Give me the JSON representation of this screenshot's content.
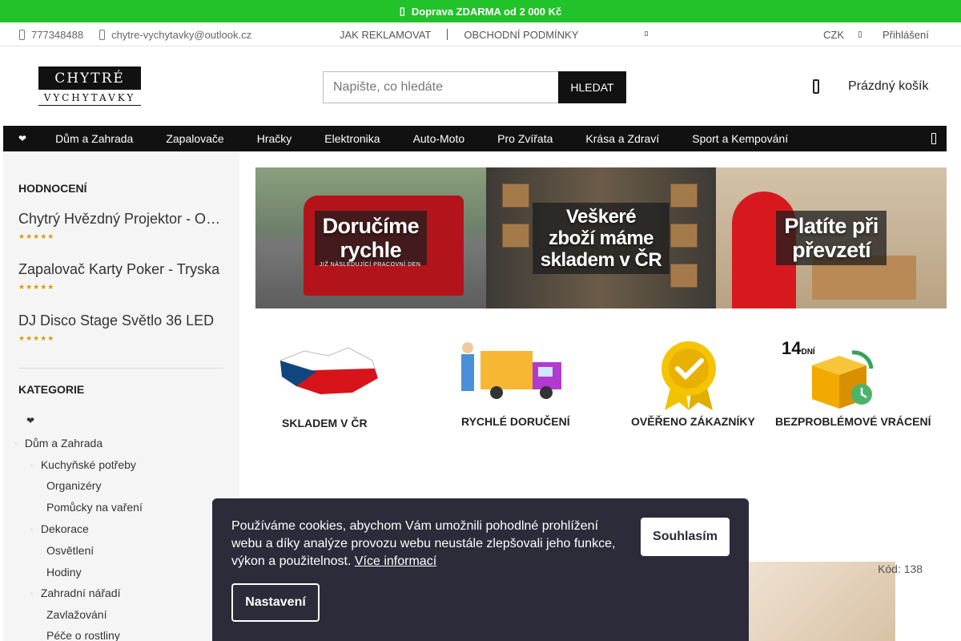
{
  "promo": {
    "text": "Doprava ZDARMA od 2 000 Kč"
  },
  "utility": {
    "phone": "777348488",
    "email": "chytre-vychytavky@outlook.cz",
    "links": [
      "JAK REKLAMOVAT",
      "OBCHODNÍ PODMÍNKY"
    ],
    "currency": "CZK",
    "login": "Přihlášení"
  },
  "header": {
    "logo_top": "CHYTRÉ",
    "logo_bottom": "VYCHYTAVKY",
    "search_placeholder": "Napište, co hledáte",
    "search_button": "HLEDAT",
    "cart": "Prázdný košík"
  },
  "nav": {
    "heart": "❤",
    "items": [
      "Dům a Zahrada",
      "Zapalovače",
      "Hračky",
      "Elektronika",
      "Auto-Moto",
      "Pro Zvířata",
      "Krása a Zdraví",
      "Sport a Kempování"
    ]
  },
  "sidebar": {
    "reviews_title": "HODNOCENÍ",
    "reviews": [
      {
        "name": "Chytrý Hvězdný Projektor - Oceán",
        "stars": "★★★★★"
      },
      {
        "name": "Zapalovač Karty Poker - Tryska",
        "stars": "★★★★★"
      },
      {
        "name": "DJ Disco Stage Světlo 36 LED",
        "stars": "★★★★★"
      }
    ],
    "categories_title": "KATEGORIE",
    "categories": [
      {
        "label": "❤",
        "level": 0
      },
      {
        "label": "Dům a Zahrada",
        "level": 1
      },
      {
        "label": "Kuchyňské potřeby",
        "level": 2
      },
      {
        "label": "Organizéry",
        "level": 3
      },
      {
        "label": "Pomůcky na vaření",
        "level": 3
      },
      {
        "label": "Dekorace",
        "level": 2
      },
      {
        "label": "Osvětlení",
        "level": 3
      },
      {
        "label": "Hodiny",
        "level": 3
      },
      {
        "label": "Zahradní nářadí",
        "level": 2
      },
      {
        "label": "Zavlažování",
        "level": 3
      },
      {
        "label": "Péče o rostliny",
        "level": 3
      }
    ]
  },
  "banners": [
    {
      "line1": "Doručíme",
      "line2": "rychle",
      "sub": "JIŽ NÁSLEDUJÍCÍ PRACOVNÍ DEN"
    },
    {
      "line1": "Veškeré",
      "line2": "zboží máme",
      "line3": "skladem v ČR"
    },
    {
      "line1": "Platíte při",
      "line2": "převzetí"
    }
  ],
  "benefits": [
    "SKLADEM V ČR",
    "RYCHLÉ DORUČENÍ",
    "OVĚŘENO ZÁKAZNÍKY",
    "BEZPROBLÉMOVÉ VRÁCENÍ"
  ],
  "benefit_days": "14",
  "benefit_days_unit": "DNÍ",
  "product": {
    "code": "Kód: 138"
  },
  "cookie": {
    "message": "Používáme cookies, abychom Vám umožnili pohodlné prohlížení webu a díky analýze provozu webu neustále zlepšovali jeho funkce, výkon a použitelnost.",
    "more": "Více informací",
    "agree": "Souhlasím",
    "settings": "Nastavení"
  },
  "colors": {
    "promo": "#22c32a",
    "nav": "#111111",
    "cookie_bg": "#2b2b3a",
    "stars": "#d89b00"
  }
}
